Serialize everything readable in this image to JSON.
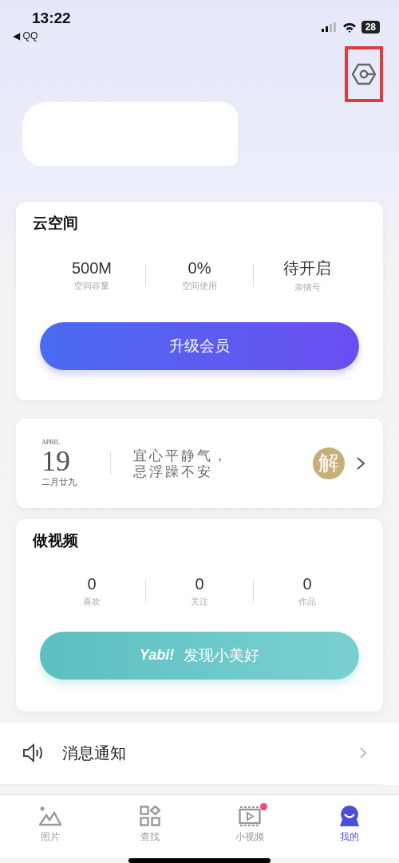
{
  "status_bar": {
    "time": "13:22",
    "back_app": "◀ QQ",
    "battery": "28"
  },
  "header": {
    "settings_highlighted": true,
    "name_redacted": true
  },
  "cloud": {
    "title": "云空间",
    "stats": [
      {
        "value": "500M",
        "label": "空间容量"
      },
      {
        "value": "0%",
        "label": "空间使用"
      },
      {
        "value": "待开启",
        "label": "亲情号"
      }
    ],
    "button": "升级会员"
  },
  "almanac": {
    "month": "APRIL",
    "day": "19",
    "lunar": "二月廿九",
    "lines": [
      "宜心平静气，",
      "忌浮躁不安"
    ],
    "badge": "解"
  },
  "video": {
    "title": "做视频",
    "stats": [
      {
        "value": "0",
        "label": "喜欢"
      },
      {
        "value": "0",
        "label": "关注"
      },
      {
        "value": "0",
        "label": "作品"
      }
    ],
    "logo": "Yabi!",
    "button": "发现小美好"
  },
  "menu": [
    {
      "label": "消息通知"
    }
  ],
  "tabs": [
    {
      "label": "照片",
      "kind": "photo",
      "selected": false,
      "dot": false
    },
    {
      "label": "查找",
      "kind": "find",
      "selected": false,
      "dot": false
    },
    {
      "label": "小视频",
      "kind": "video",
      "selected": false,
      "dot": true
    },
    {
      "label": "我的",
      "kind": "me",
      "selected": true,
      "dot": false
    }
  ]
}
